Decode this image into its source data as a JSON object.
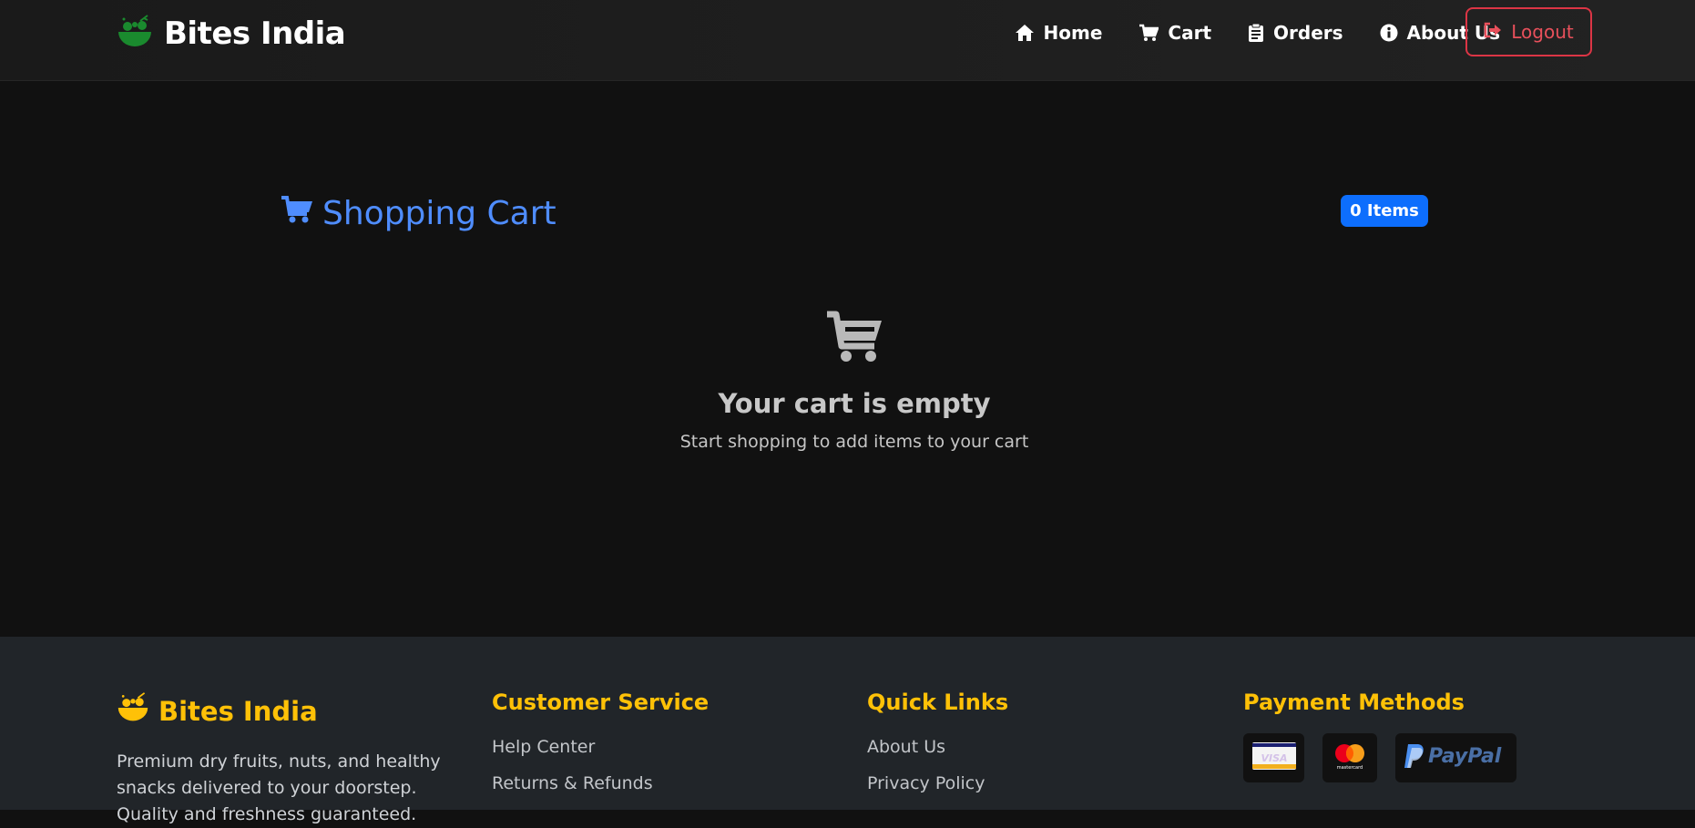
{
  "navbar": {
    "brand": "Bites India",
    "links": [
      {
        "label": "Home",
        "icon": "home-icon"
      },
      {
        "label": "Cart",
        "icon": "cart-icon"
      },
      {
        "label": "Orders",
        "icon": "clipboard-icon"
      },
      {
        "label": "About Us",
        "icon": "info-icon"
      }
    ],
    "logout_label": "Logout"
  },
  "cart": {
    "title": "Shopping Cart",
    "badge": "0 Items",
    "empty_title": "Your cart is empty",
    "empty_subtitle": "Start shopping to add items to your cart"
  },
  "footer": {
    "brand": "Bites India",
    "description": "Premium dry fruits, nuts, and healthy snacks delivered to your doorstep. Quality and freshness guaranteed.",
    "customer_service": {
      "heading": "Customer Service",
      "links": [
        "Help Center",
        "Returns & Refunds"
      ]
    },
    "quick_links": {
      "heading": "Quick Links",
      "links": [
        "About Us",
        "Privacy Policy"
      ]
    },
    "payment": {
      "heading": "Payment Methods",
      "methods": [
        "VISA",
        "mastercard",
        "PayPal"
      ]
    }
  },
  "colors": {
    "accent_blue": "#4f8dff",
    "badge_blue": "#0d6efd",
    "footer_gold": "#ffc107",
    "logout_red": "#dc3545",
    "brand_green": "#1a8a2e"
  }
}
